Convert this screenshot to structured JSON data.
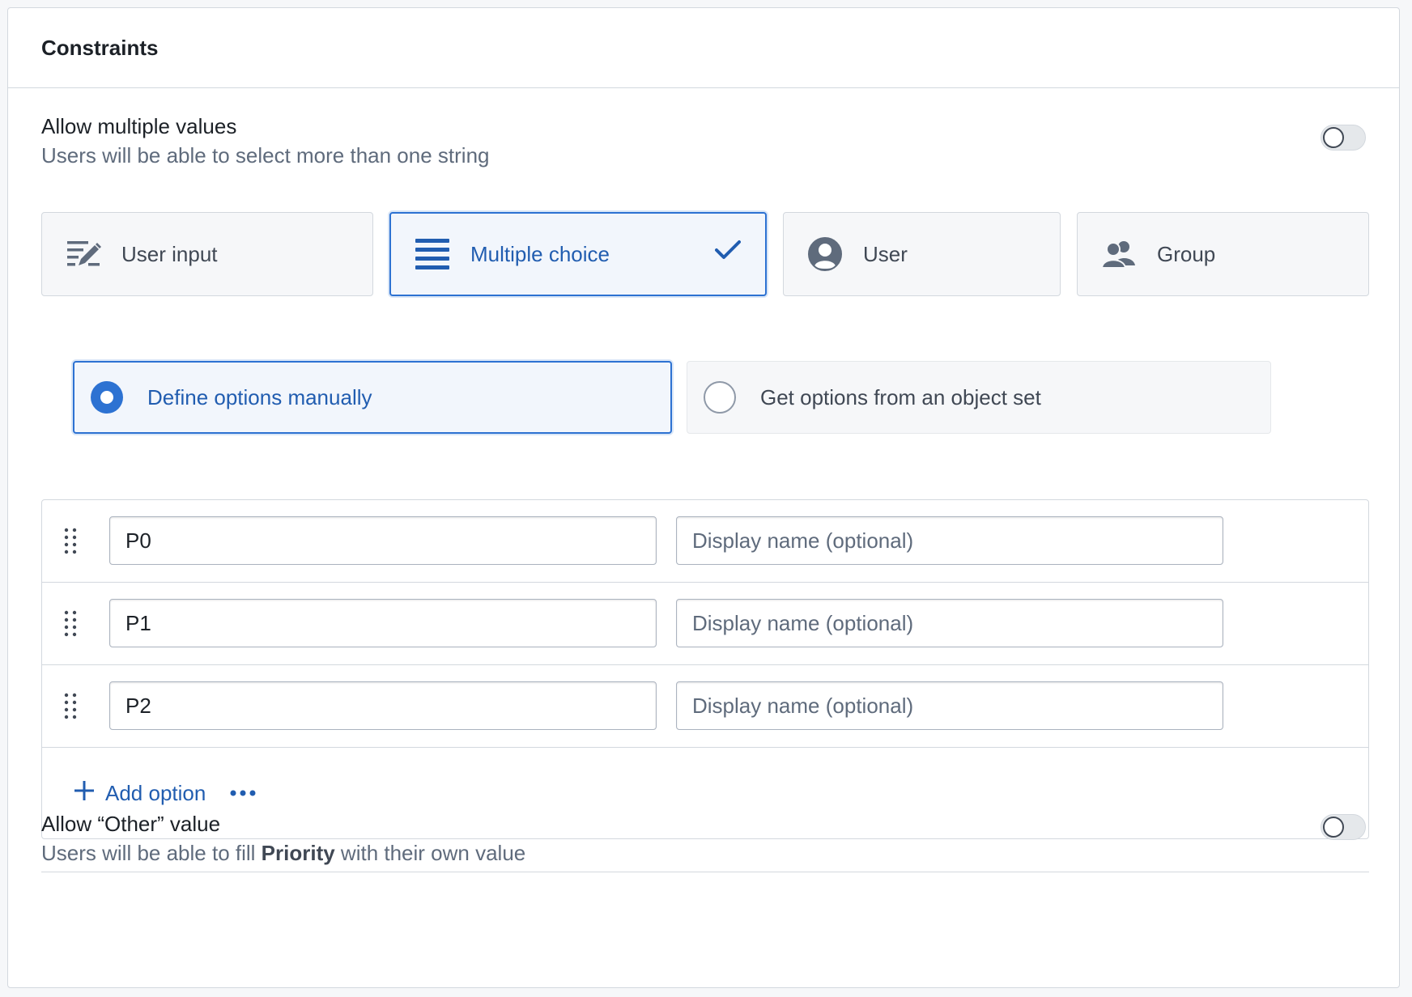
{
  "panel": {
    "title": "Constraints"
  },
  "multiple_values": {
    "label": "Allow multiple values",
    "description": "Users will be able to select more than one string",
    "enabled": false
  },
  "input_types": [
    {
      "label": "User input",
      "icon": "pencil-list-icon",
      "selected": false
    },
    {
      "label": "Multiple choice",
      "icon": "list-icon",
      "selected": true
    },
    {
      "label": "User",
      "icon": "person-icon",
      "selected": false
    },
    {
      "label": "Group",
      "icon": "people-icon",
      "selected": false
    }
  ],
  "option_sources": [
    {
      "label": "Define options manually",
      "selected": true
    },
    {
      "label": "Get options from an object set",
      "selected": false
    }
  ],
  "options": [
    {
      "value": "P0",
      "display_placeholder": "Display name (optional)"
    },
    {
      "value": "P1",
      "display_placeholder": "Display name (optional)"
    },
    {
      "value": "P2",
      "display_placeholder": "Display name (optional)"
    }
  ],
  "add_option_label": "Add option",
  "other_value": {
    "label": "Allow “Other” value",
    "description_prefix": "Users will be able to fill ",
    "description_bold": "Priority",
    "description_suffix": " with their own value",
    "enabled": false
  },
  "colors": {
    "accent": "#2d72d2",
    "accent_text": "#215db0",
    "border": "#d3d8de",
    "muted_text": "#5f6b7c"
  }
}
